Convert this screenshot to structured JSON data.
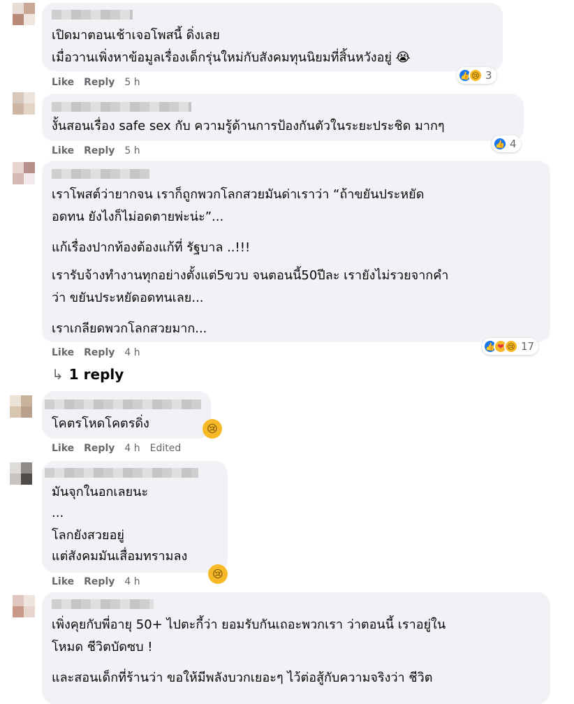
{
  "comments": [
    {
      "lines": [
        "เปิดมาตอนเช้าเจอโพสนี้ ดิ่งเลย",
        "เมื่อวานเพิ่งหาข้อมูลเรื่องเด็กรุ่นใหม่กับสังคมทุนนิยมที่สิ้นหวังอยู่ 😭"
      ],
      "like": "Like",
      "reply": "Reply",
      "time": "5 h",
      "reactions": [
        "like-icon",
        "sad-icon"
      ],
      "reaction_count": "3"
    },
    {
      "lines": [
        "งั้นสอนเรื่อง safe sex กับ ความรู้ด้านการป้องกันตัวในระยะประชิด มากๆ"
      ],
      "like": "Like",
      "reply": "Reply",
      "time": "5 h",
      "reactions": [
        "like-icon"
      ],
      "reaction_count": "4"
    },
    {
      "lines": [
        "เราโพสต์ว่ายากจน เราก็ถูกพวกโลกสวยมันด่าเราว่า “ถ้าขยันประหยัด",
        "อดทน ยังไงก็ไม่อดตายพ่ะน่ะ”...",
        "แก้เรื่องปากท้องต้องแก้ที่ รัฐบาล ..!!!",
        "เรารับจ้างทำงานทุกอย่างตั้งแต่5ขวบ จนตอนนี้50ปีละ เรายังไม่รวยจากคำ",
        "ว่า ขยันประหยัดอดทนเลย...",
        "เราเกลียดพวกโลกสวยมาก..."
      ],
      "like": "Like",
      "reply": "Reply",
      "time": "4 h",
      "reactions": [
        "like-icon",
        "care-icon",
        "sad-icon"
      ],
      "reaction_count": "17",
      "replies_label": "1 reply"
    },
    {
      "lines": [
        "โคตรโหดโคตรดิ่ง"
      ],
      "like": "Like",
      "reply": "Reply",
      "time": "4 h",
      "edited": "Edited",
      "reactions": [
        "sad-icon"
      ]
    },
    {
      "lines": [
        "มันจุกในอกเลยนะ",
        "...",
        "โลกยังสวยอยู่",
        "แต่สังคมมันเสื่อมทรามลง"
      ],
      "like": "Like",
      "reply": "Reply",
      "time": "4 h",
      "reactions": [
        "sad-icon"
      ]
    },
    {
      "lines": [
        "เพิ่งคุยกับพี่อายุ 50+ ไปตะกี้ว่า ยอมรับกันเถอะพวกเรา ว่าตอนนี้ เราอยู่ใน",
        "โหมด ชีวิตบัดซบ !",
        "และสอนเด็กที่ร้านว่า ขอให้มีพลังบวกเยอะๆ ไว้ต่อสู้กับความจริงว่า ชีวิต"
      ]
    }
  ],
  "colors": {
    "bubble": "#f0f2f5",
    "meta": "#65676b",
    "like_blue": "#1877f2",
    "sad_yellow": "#f7b928"
  }
}
